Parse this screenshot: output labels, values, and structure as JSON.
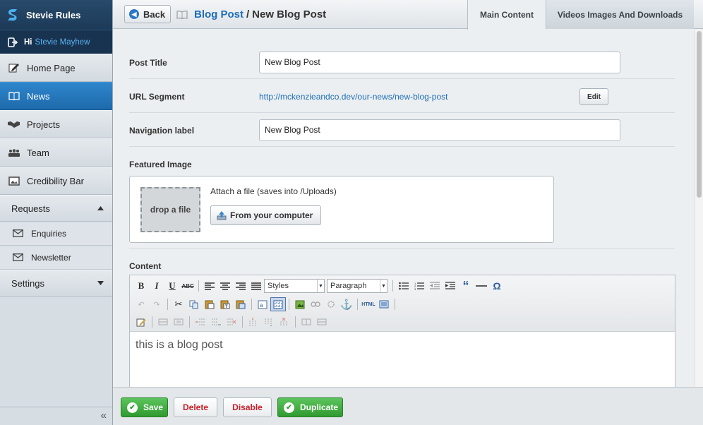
{
  "app": {
    "brand": "Stevie Rules"
  },
  "user": {
    "greeting": "Hi",
    "name": "Stevie Mayhew"
  },
  "sidebar": {
    "items": [
      {
        "label": "Home Page",
        "icon": "edit-page-icon"
      },
      {
        "label": "News",
        "icon": "book-icon",
        "active": true
      },
      {
        "label": "Projects",
        "icon": "handshake-icon"
      },
      {
        "label": "Team",
        "icon": "people-icon"
      },
      {
        "label": "Credibility Bar",
        "icon": "image-icon"
      }
    ],
    "requests": {
      "label": "Requests",
      "children": [
        {
          "label": "Enquiries",
          "icon": "envelope-icon"
        },
        {
          "label": "Newsletter",
          "icon": "envelope-icon"
        }
      ]
    },
    "settings": {
      "label": "Settings"
    },
    "collapse_glyph": "«"
  },
  "header": {
    "back_label": "Back",
    "breadcrumb_parent": "Blog Post",
    "breadcrumb_separator": "/",
    "breadcrumb_current": "New Blog Post"
  },
  "tabs": [
    {
      "label": "Main Content",
      "active": true
    },
    {
      "label": "Videos Images And Downloads",
      "active": false
    }
  ],
  "form": {
    "post_title": {
      "label": "Post Title",
      "value": "New Blog Post"
    },
    "url_segment": {
      "label": "URL Segment",
      "value": "http://mckenzieandco.dev/our-news/new-blog-post",
      "edit_label": "Edit"
    },
    "nav_label": {
      "label": "Navigation label",
      "value": "New Blog Post"
    },
    "featured_image": {
      "label": "Featured Image",
      "dropzone": "drop a file",
      "attach_text": "Attach a file (saves into /Uploads)",
      "computer_button": "From your computer"
    },
    "content": {
      "label": "Content",
      "styles_select": "Styles",
      "format_select": "Paragraph",
      "body": "this is a blog post"
    }
  },
  "footer": {
    "save": "Save",
    "delete": "Delete",
    "disable": "Disable",
    "duplicate": "Duplicate"
  },
  "colors": {
    "accent": "#1f6fb8",
    "nav_active": "#2477bd",
    "green": "#3aa53a",
    "danger": "#c8202a"
  }
}
